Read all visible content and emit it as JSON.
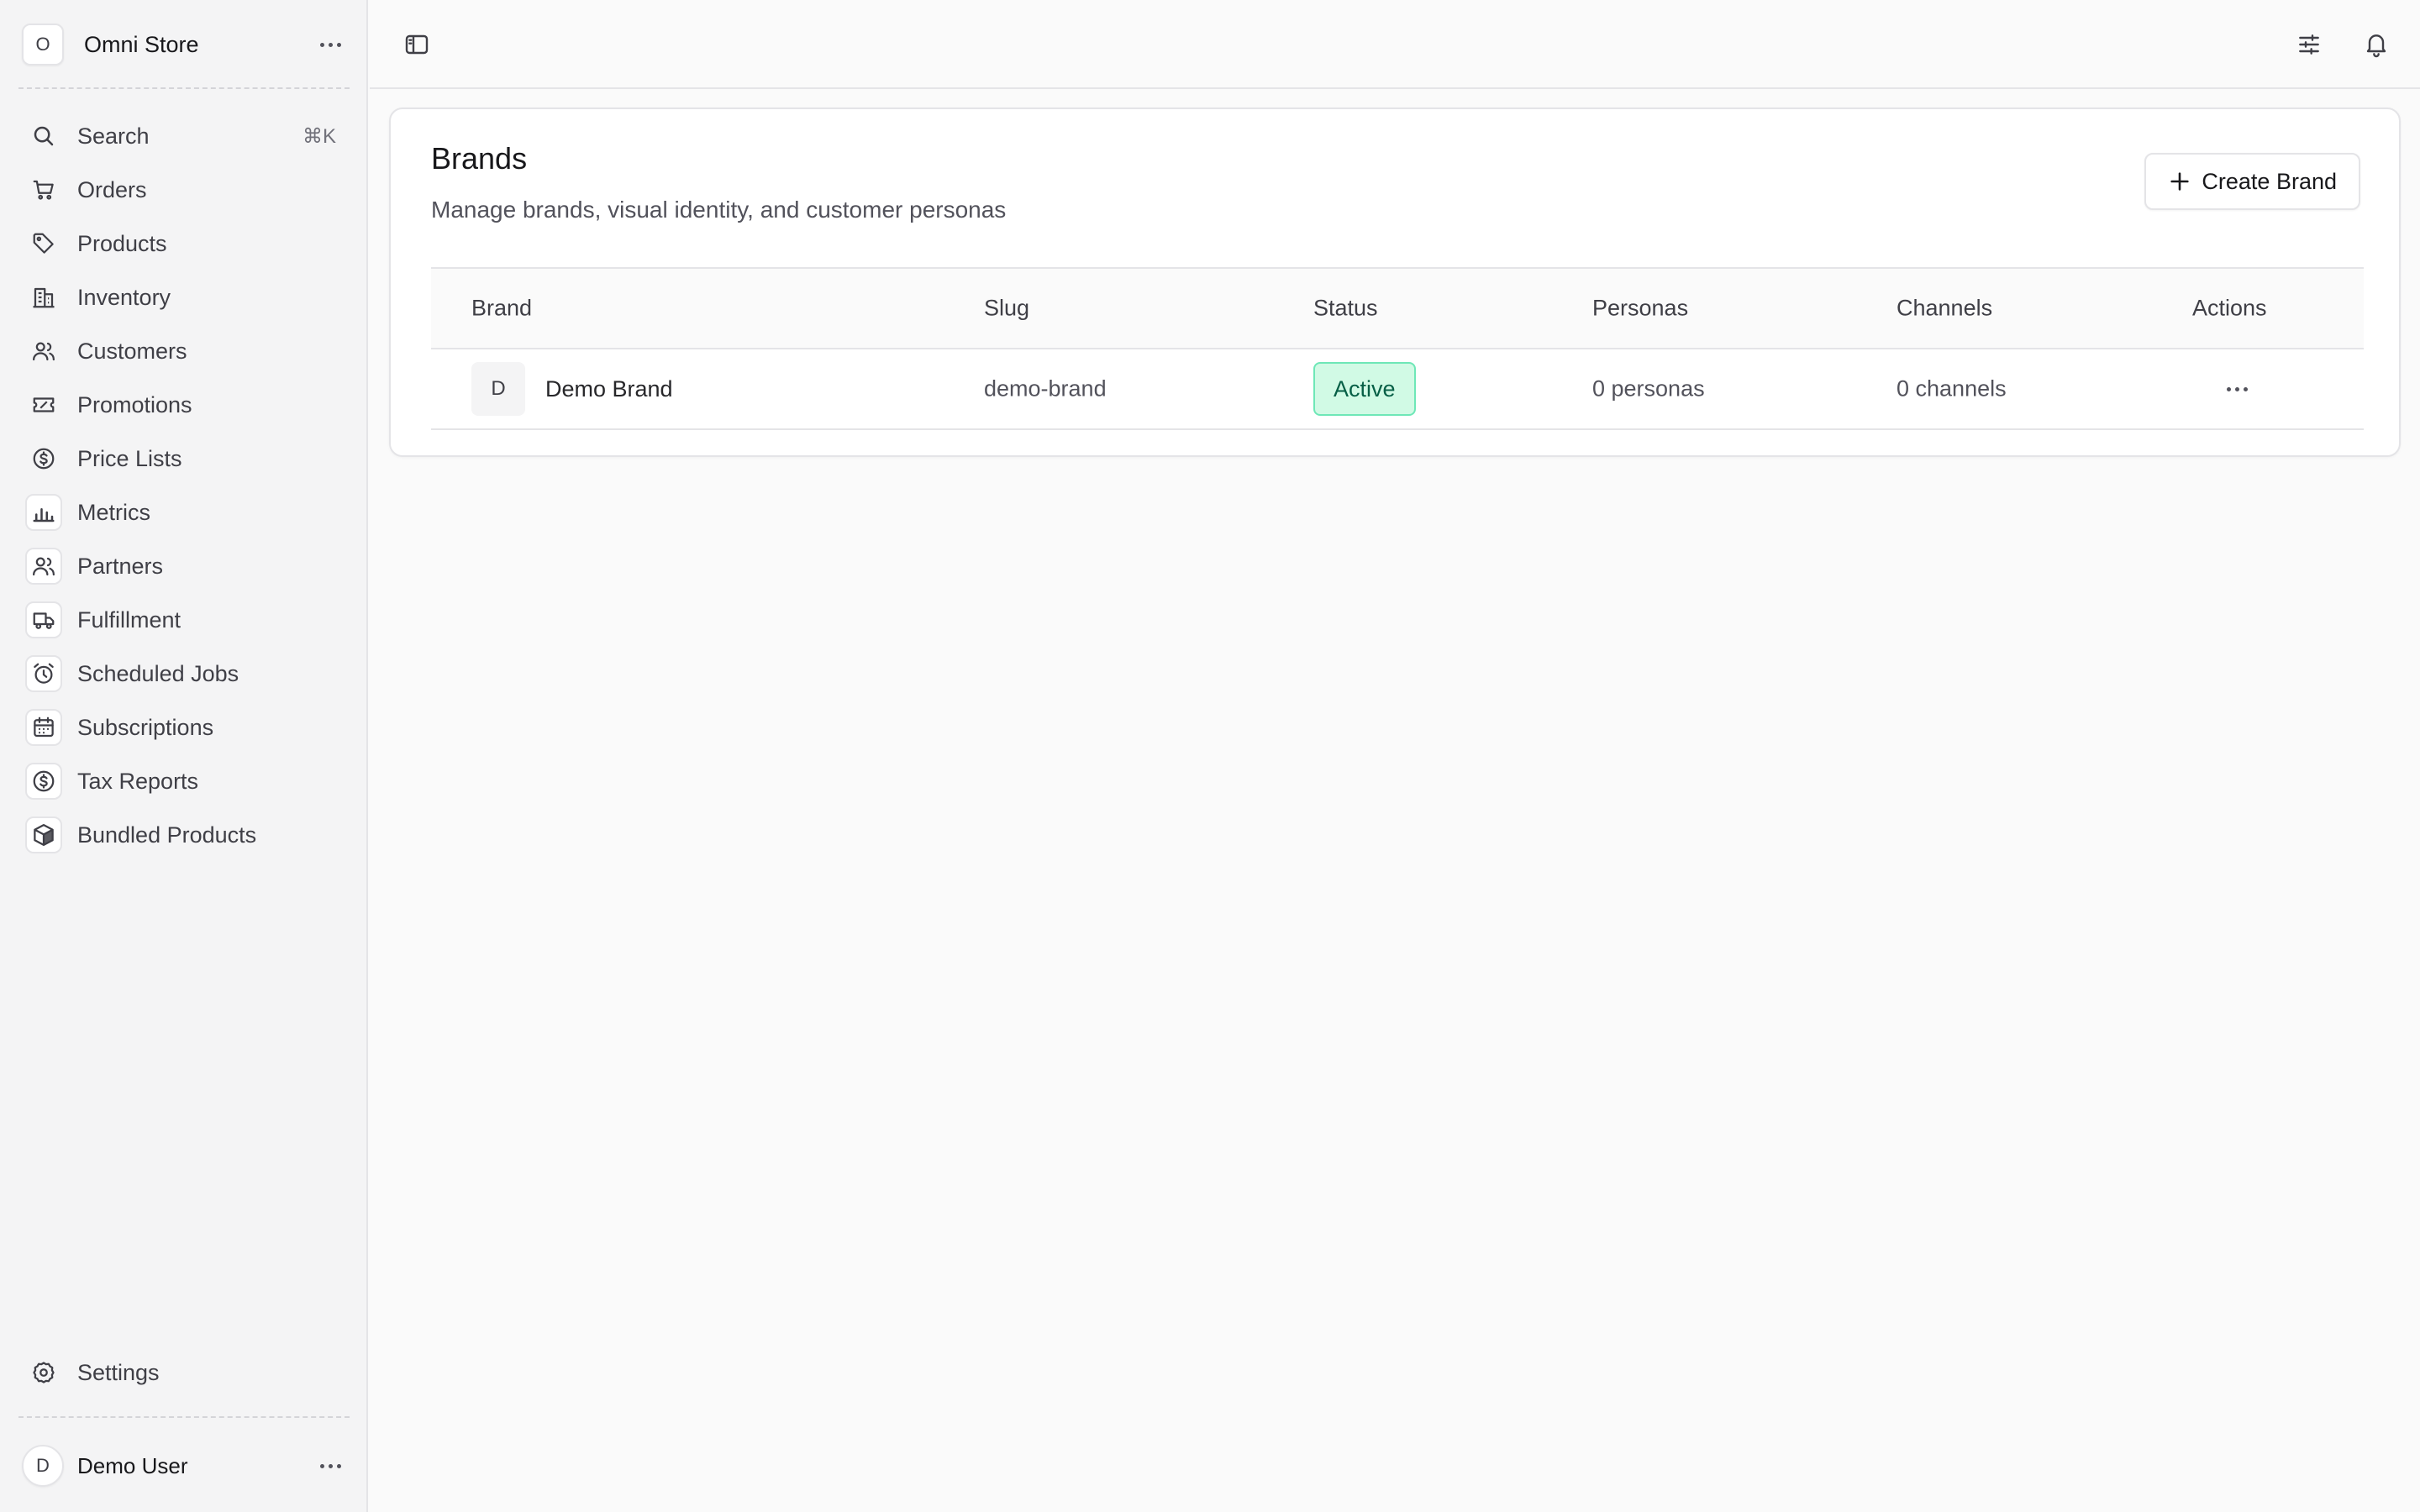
{
  "sidebar": {
    "store_initial": "O",
    "store_name": "Omni Store",
    "search": {
      "label": "Search",
      "shortcut": "⌘K"
    },
    "items": [
      {
        "label": "Orders",
        "icon": "cart-icon"
      },
      {
        "label": "Products",
        "icon": "tag-icon"
      },
      {
        "label": "Inventory",
        "icon": "building-icon"
      },
      {
        "label": "Customers",
        "icon": "users-icon"
      },
      {
        "label": "Promotions",
        "icon": "ticket-icon"
      },
      {
        "label": "Price Lists",
        "icon": "dollar-circle-icon"
      },
      {
        "label": "Metrics",
        "icon": "bar-chart-icon"
      },
      {
        "label": "Partners",
        "icon": "users-icon"
      },
      {
        "label": "Fulfillment",
        "icon": "truck-icon"
      },
      {
        "label": "Scheduled Jobs",
        "icon": "alarm-clock-icon"
      },
      {
        "label": "Subscriptions",
        "icon": "calendar-icon"
      },
      {
        "label": "Tax Reports",
        "icon": "dollar-circle-icon"
      },
      {
        "label": "Bundled Products",
        "icon": "box-icon"
      }
    ],
    "settings_label": "Settings",
    "user_initial": "D",
    "user_name": "Demo User"
  },
  "page": {
    "title": "Brands",
    "subtitle": "Manage brands, visual identity, and customer personas",
    "create_label": "Create Brand"
  },
  "table": {
    "headers": [
      "Brand",
      "Slug",
      "Status",
      "Personas",
      "Channels",
      "Actions"
    ],
    "rows": [
      {
        "initial": "D",
        "brand": "Demo Brand",
        "slug": "demo-brand",
        "status": "Active",
        "personas": "0 personas",
        "channels": "0 channels"
      }
    ]
  },
  "colors": {
    "active_bg": "#d1fae5",
    "active_border": "#6ee7b7",
    "active_text": "#065f46"
  }
}
